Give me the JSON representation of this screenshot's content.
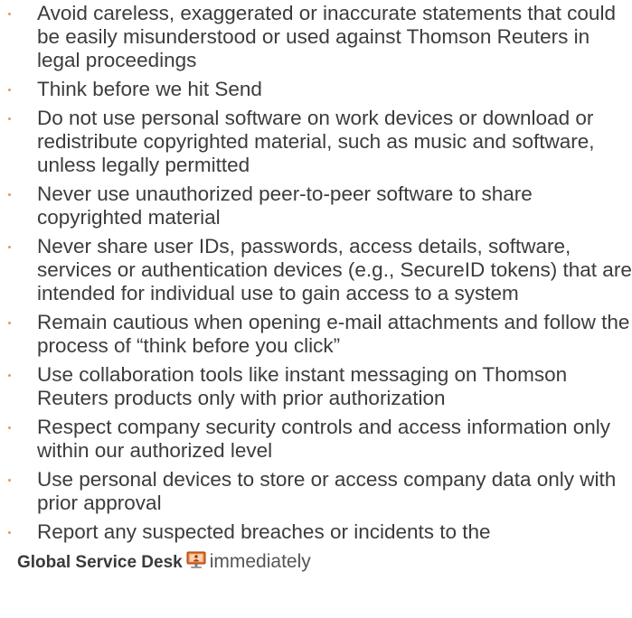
{
  "bullets": [
    "Avoid careless, exaggerated or inaccurate statements that could be easily misunderstood or used against Thomson Reuters in legal proceedings",
    "Think before we hit Send",
    "Do not use personal software on work devices or download or redistribute copyrighted material, such as music and software, unless legally permitted",
    "Never use unauthorized peer-to-peer software to share copyrighted material",
    "Never share user IDs, passwords, access details, software, services or authentication devices (e.g., SecureID tokens) that are intended for individual use to gain access to a system",
    "Remain cautious when opening e-mail attachments and follow the process of “think before you click”",
    "Use collaboration tools like instant messaging on Thomson Reuters products only with prior authorization",
    "Respect company security controls and access information only within our authorized level",
    "Use personal devices to store or access company data only with prior approval"
  ],
  "last_item": {
    "text": "Report any suspected breaches or incidents to the",
    "link_label": "Global Service Desk",
    "after_text": "immediately",
    "icon": "monitor-icon"
  },
  "colors": {
    "bullet": "#f0954f",
    "text": "#3c3c3c",
    "icon_body": "#e8702a"
  }
}
